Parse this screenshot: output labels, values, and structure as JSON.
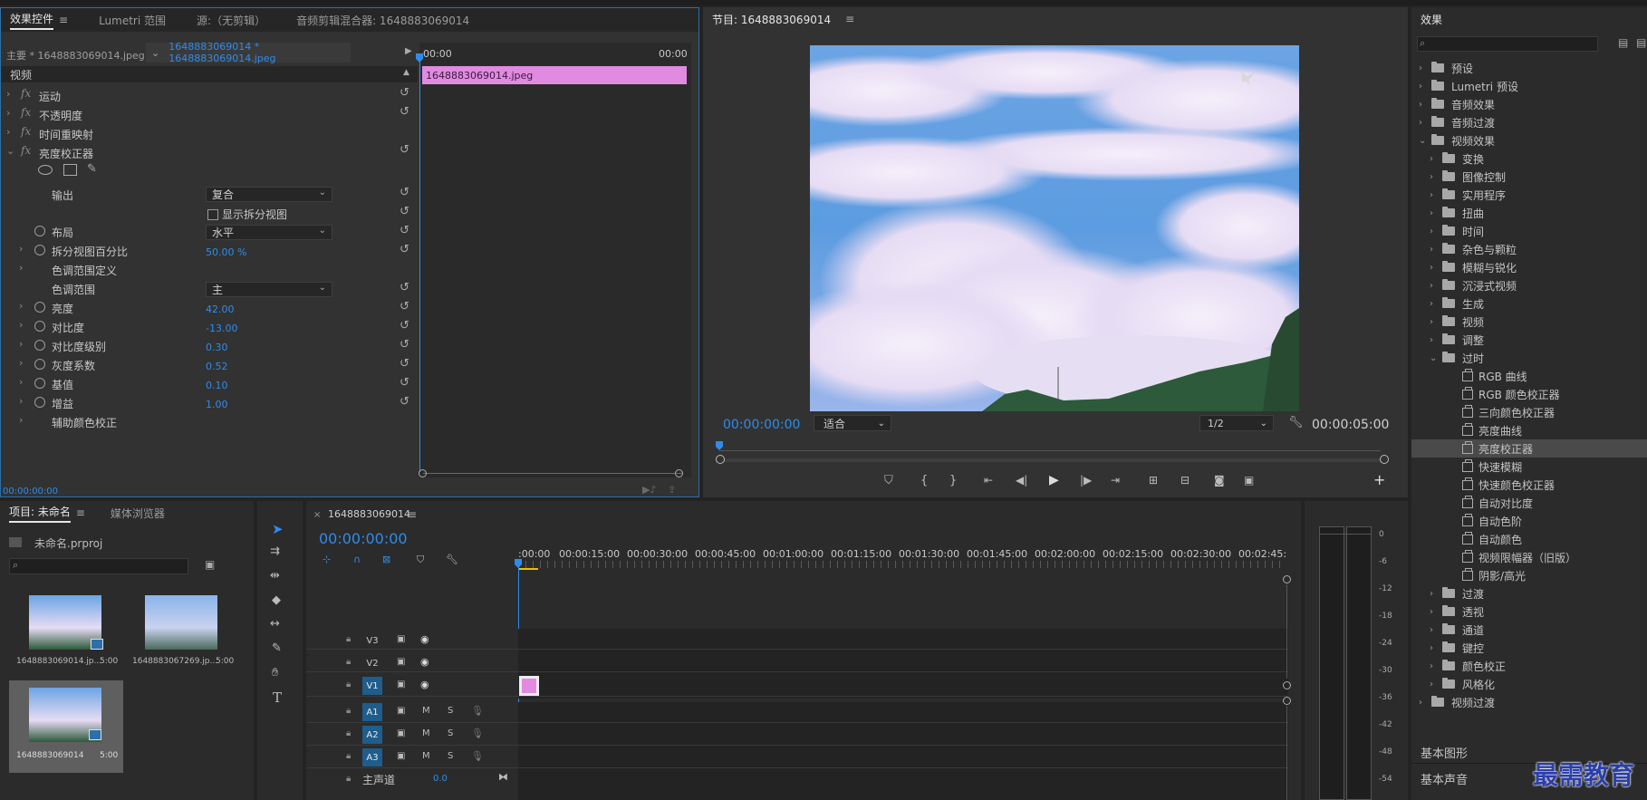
{
  "colors": {
    "accent": "#2d8ceb",
    "clip": "#e08ae0",
    "selection": "#1e5d8c"
  },
  "effect_controls": {
    "tabs": [
      "效果控件",
      "Lumetri 范围",
      "源:（无剪辑）",
      "音频剪辑混合器: 1648883069014"
    ],
    "master_label": "主要 * 1648883069014.jpeg",
    "sequence_clip": "1648883069014 * 1648883069014.jpeg",
    "time_start": "00:00",
    "time_end": "00:00",
    "clip_label": "1648883069014.jpeg",
    "section": "视频",
    "effects": [
      "运动",
      "不透明度",
      "时间重映射",
      "亮度校正器"
    ],
    "props": {
      "output_label": "输出",
      "output_value": "复合",
      "split_label": "显示拆分视图",
      "layout_label": "布局",
      "layout_value": "水平",
      "split_pct_label": "拆分视图百分比",
      "split_pct_value": "50.00 %",
      "tonal_def_label": "色调范围定义",
      "tonal_label": "色调范围",
      "tonal_value": "主",
      "brightness_label": "亮度",
      "brightness_value": "42.00",
      "contrast_label": "对比度",
      "contrast_value": "-13.00",
      "contrast_level_label": "对比度级别",
      "contrast_level_value": "0.30",
      "gamma_label": "灰度系数",
      "gamma_value": "0.52",
      "pedestal_label": "基值",
      "pedestal_value": "0.10",
      "gain_label": "增益",
      "gain_value": "1.00",
      "secondary_label": "辅助颜色校正"
    },
    "timecode": "00:00:00:00"
  },
  "program": {
    "title": "节目: 1648883069014",
    "timecode": "00:00:00:00",
    "fit": "适合",
    "resolution": "1/2",
    "duration": "00:00:05:00"
  },
  "effects_panel": {
    "title": "效果",
    "items": [
      {
        "label": "预设",
        "level": 0,
        "icon": "folder-star"
      },
      {
        "label": "Lumetri 预设",
        "level": 0,
        "icon": "folder-star"
      },
      {
        "label": "音频效果",
        "level": 0,
        "icon": "folder"
      },
      {
        "label": "音频过渡",
        "level": 0,
        "icon": "folder"
      },
      {
        "label": "视频效果",
        "level": 0,
        "icon": "folder",
        "open": true
      },
      {
        "label": "变换",
        "level": 1,
        "icon": "folder"
      },
      {
        "label": "图像控制",
        "level": 1,
        "icon": "folder"
      },
      {
        "label": "实用程序",
        "level": 1,
        "icon": "folder"
      },
      {
        "label": "扭曲",
        "level": 1,
        "icon": "folder"
      },
      {
        "label": "时间",
        "level": 1,
        "icon": "folder"
      },
      {
        "label": "杂色与颗粒",
        "level": 1,
        "icon": "folder"
      },
      {
        "label": "模糊与锐化",
        "level": 1,
        "icon": "folder"
      },
      {
        "label": "沉浸式视频",
        "level": 1,
        "icon": "folder"
      },
      {
        "label": "生成",
        "level": 1,
        "icon": "folder"
      },
      {
        "label": "视频",
        "level": 1,
        "icon": "folder"
      },
      {
        "label": "调整",
        "level": 1,
        "icon": "folder"
      },
      {
        "label": "过时",
        "level": 1,
        "icon": "folder",
        "open": true
      },
      {
        "label": "RGB 曲线",
        "level": 2,
        "icon": "effect"
      },
      {
        "label": "RGB 颜色校正器",
        "level": 2,
        "icon": "effect"
      },
      {
        "label": "三向颜色校正器",
        "level": 2,
        "icon": "effect"
      },
      {
        "label": "亮度曲线",
        "level": 2,
        "icon": "effect"
      },
      {
        "label": "亮度校正器",
        "level": 2,
        "icon": "effect",
        "selected": true
      },
      {
        "label": "快速模糊",
        "level": 2,
        "icon": "effect"
      },
      {
        "label": "快速颜色校正器",
        "level": 2,
        "icon": "effect"
      },
      {
        "label": "自动对比度",
        "level": 2,
        "icon": "effect"
      },
      {
        "label": "自动色阶",
        "level": 2,
        "icon": "effect"
      },
      {
        "label": "自动颜色",
        "level": 2,
        "icon": "effect"
      },
      {
        "label": "视频限幅器（旧版）",
        "level": 2,
        "icon": "effect"
      },
      {
        "label": "阴影/高光",
        "level": 2,
        "icon": "effect"
      },
      {
        "label": "过渡",
        "level": 1,
        "icon": "folder"
      },
      {
        "label": "透视",
        "level": 1,
        "icon": "folder"
      },
      {
        "label": "通道",
        "level": 1,
        "icon": "folder"
      },
      {
        "label": "键控",
        "level": 1,
        "icon": "folder"
      },
      {
        "label": "颜色校正",
        "level": 1,
        "icon": "folder"
      },
      {
        "label": "风格化",
        "level": 1,
        "icon": "folder"
      },
      {
        "label": "视频过渡",
        "level": 0,
        "icon": "folder"
      }
    ],
    "extra_panels": [
      "基本图形",
      "基本声音"
    ]
  },
  "project": {
    "tabs": [
      "项目: 未命名",
      "媒体浏览器"
    ],
    "file": "未命名.prproj",
    "items": [
      {
        "name": "1648883069014.jp...",
        "duration": "5:00"
      },
      {
        "name": "1648883067269.jp...",
        "duration": "5:00"
      },
      {
        "name": "1648883069014",
        "duration": "5:00"
      }
    ]
  },
  "timeline": {
    "title": "1648883069014",
    "timecode": "00:00:00:00",
    "ruler": [
      ":00:00",
      "00:00:15:00",
      "00:00:30:00",
      "00:00:45:00",
      "00:01:00:00",
      "00:01:15:00",
      "00:01:30:00",
      "00:01:45:00",
      "00:02:00:00",
      "00:02:15:00",
      "00:02:30:00",
      "00:02:45:"
    ],
    "tracks_video": [
      "V3",
      "V2",
      "V1"
    ],
    "tracks_audio": [
      "A1",
      "A2",
      "A3"
    ],
    "master": "主声道",
    "master_value": "0.0",
    "m": "M",
    "s": "S"
  },
  "meter": {
    "scale": [
      "0",
      "-6",
      "-12",
      "-18",
      "-24",
      "-30",
      "-36",
      "-42",
      "-48",
      "-54"
    ]
  },
  "watermark": "最需教育"
}
